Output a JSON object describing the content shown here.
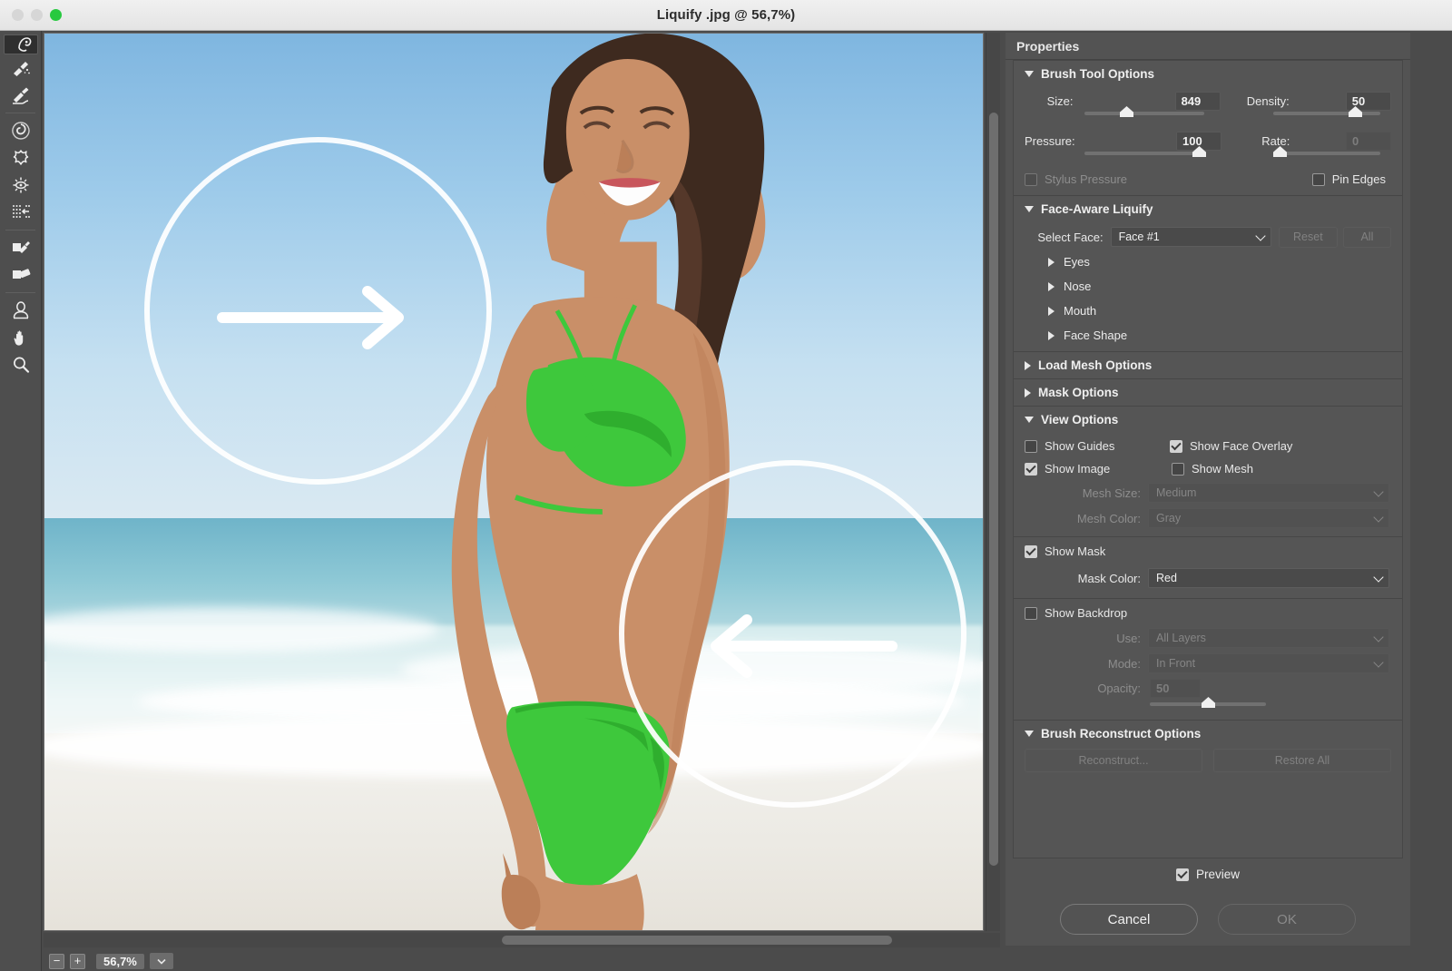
{
  "window": {
    "title": "Liquify .jpg @ 56,7%)",
    "traffic_lights": [
      "close",
      "minimize",
      "zoom"
    ]
  },
  "toolbar": {
    "tools": [
      {
        "name": "forward-warp-tool",
        "label": "Forward Warp Tool",
        "selected": true
      },
      {
        "name": "reconstruct-tool",
        "label": "Reconstruct Tool",
        "selected": false
      },
      {
        "name": "smooth-tool",
        "label": "Smooth Tool",
        "selected": false
      },
      {
        "name": "twirl-clockwise-tool",
        "label": "Twirl Clockwise Tool",
        "selected": false
      },
      {
        "name": "pucker-tool",
        "label": "Pucker Tool",
        "selected": false
      },
      {
        "name": "bloat-tool",
        "label": "Bloat Tool",
        "selected": false
      },
      {
        "name": "push-left-tool",
        "label": "Push Left Tool",
        "selected": false
      },
      {
        "name": "freeze-mask-tool",
        "label": "Freeze Mask Tool",
        "selected": false
      },
      {
        "name": "thaw-mask-tool",
        "label": "Thaw Mask Tool",
        "selected": false
      },
      {
        "name": "face-tool",
        "label": "Face Tool",
        "selected": false
      },
      {
        "name": "hand-tool",
        "label": "Hand Tool",
        "selected": false
      },
      {
        "name": "zoom-tool",
        "label": "Zoom Tool",
        "selected": false
      }
    ]
  },
  "statusbar": {
    "zoom_out_label": "−",
    "zoom_in_label": "+",
    "zoom_value": "56,7%"
  },
  "properties": {
    "header": "Properties",
    "brush_tool_options": {
      "title": "Brush Tool Options",
      "expanded": true,
      "size_label": "Size:",
      "size_value": "849",
      "size_percent": 35,
      "density_label": "Density:",
      "density_value": "50",
      "density_percent": 77,
      "pressure_label": "Pressure:",
      "pressure_value": "100",
      "pressure_percent": 100,
      "rate_label": "Rate:",
      "rate_value": "0",
      "rate_percent": 0,
      "stylus_pressure_label": "Stylus Pressure",
      "stylus_pressure_checked": false,
      "stylus_pressure_enabled": false,
      "pin_edges_label": "Pin Edges",
      "pin_edges_checked": false
    },
    "face_aware_liquify": {
      "title": "Face-Aware Liquify",
      "expanded": true,
      "select_face_label": "Select Face:",
      "select_face_value": "Face #1",
      "reset_label": "Reset",
      "all_label": "All",
      "subsections": [
        "Eyes",
        "Nose",
        "Mouth",
        "Face Shape"
      ]
    },
    "load_mesh_options": {
      "title": "Load Mesh Options",
      "expanded": false
    },
    "mask_options": {
      "title": "Mask Options",
      "expanded": false
    },
    "view_options": {
      "title": "View Options",
      "expanded": true,
      "show_guides_label": "Show Guides",
      "show_guides_checked": false,
      "show_face_overlay_label": "Show Face Overlay",
      "show_face_overlay_checked": true,
      "show_image_label": "Show Image",
      "show_image_checked": true,
      "show_mesh_label": "Show Mesh",
      "show_mesh_checked": false,
      "mesh_size_label": "Mesh Size:",
      "mesh_size_value": "Medium",
      "mesh_color_label": "Mesh Color:",
      "mesh_color_value": "Gray",
      "show_mask_label": "Show Mask",
      "show_mask_checked": true,
      "mask_color_label": "Mask Color:",
      "mask_color_value": "Red",
      "show_backdrop_label": "Show Backdrop",
      "show_backdrop_checked": false,
      "use_label": "Use:",
      "use_value": "All Layers",
      "mode_label": "Mode:",
      "mode_value": "In Front",
      "opacity_label": "Opacity:",
      "opacity_value": "50",
      "opacity_percent": 50
    },
    "brush_reconstruct_options": {
      "title": "Brush Reconstruct Options",
      "expanded": true,
      "reconstruct_label": "Reconstruct...",
      "restore_all_label": "Restore All"
    },
    "preview_label": "Preview",
    "preview_checked": true,
    "cancel_label": "Cancel",
    "ok_label": "OK"
  },
  "canvas": {
    "annotations": [
      {
        "name": "annotation-circle-right-arrow",
        "direction": "right"
      },
      {
        "name": "annotation-circle-left-arrow",
        "direction": "left"
      }
    ]
  },
  "colors": {
    "panel_bg": "#535353",
    "toolbar_bg": "#4e4e4e",
    "accent_green": "#3ec83c",
    "title_bar": "#ececec"
  }
}
